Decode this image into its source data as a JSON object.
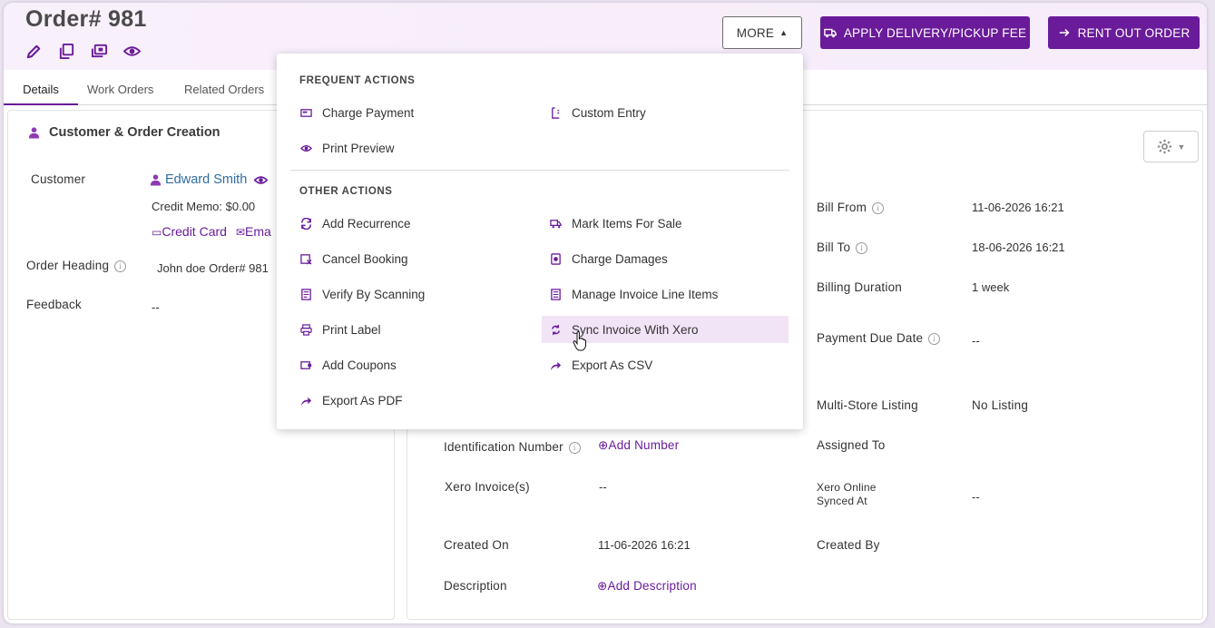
{
  "header": {
    "order_title": "Order# 981",
    "more_label": "MORE",
    "fee_label": "APPLY DELIVERY/PICKUP FEE",
    "rent_label": "RENT OUT ORDER"
  },
  "tabs": [
    {
      "label": "Details"
    },
    {
      "label": "Work Orders"
    },
    {
      "label": "Related Orders"
    }
  ],
  "left_panel": {
    "title": "Customer & Order Creation",
    "customer_label": "Customer",
    "customer_name": "Edward Smith",
    "credit_memo": "Credit Memo: $0.00",
    "credit_card": "Credit Card",
    "email": "Ema",
    "order_heading_label": "Order Heading",
    "order_heading_value": "John doe Order# 981",
    "feedback_label": "Feedback",
    "feedback_value": "--"
  },
  "right_panel": {
    "bill_from_label": "Bill From",
    "bill_from_value": "11-06-2026 16:21",
    "bill_to_label": "Bill To",
    "bill_to_value": "18-06-2026 16:21",
    "billing_duration_label": "Billing Duration",
    "billing_duration_value": "1 week",
    "payment_due_label": "Payment Due Date",
    "payment_due_value": "--",
    "multi_store_label": "Multi-Store Listing",
    "multi_store_value": "No Listing",
    "identification_label": "Identification Number",
    "add_number": "Add Number",
    "assigned_to_label": "Assigned To",
    "xero_invoice_label": "Xero Invoice(s)",
    "xero_invoice_value": "--",
    "xero_online_label_1": "Xero Online",
    "xero_online_label_2": "Synced At",
    "xero_online_value": "--",
    "created_on_label": "Created On",
    "created_on_value": "11-06-2026 16:21",
    "created_by_label": "Created By",
    "description_label": "Description",
    "add_description": "Add Description"
  },
  "dropdown": {
    "frequent_header": "FREQUENT ACTIONS",
    "other_header": "OTHER ACTIONS",
    "frequent": [
      {
        "label": "Charge Payment",
        "icon": "payment-icon"
      },
      {
        "label": "Custom Entry",
        "icon": "custom-entry-icon"
      },
      {
        "label": "Print Preview",
        "icon": "eye-icon"
      }
    ],
    "other": [
      {
        "label": "Add Recurrence",
        "icon": "recurrence-icon"
      },
      {
        "label": "Mark Items For Sale",
        "icon": "truck-icon"
      },
      {
        "label": "Cancel Booking",
        "icon": "cancel-booking-icon"
      },
      {
        "label": "Charge Damages",
        "icon": "damages-icon"
      },
      {
        "label": "Verify By Scanning",
        "icon": "scan-icon"
      },
      {
        "label": "Manage Invoice Line Items",
        "icon": "invoice-icon"
      },
      {
        "label": "Print Label",
        "icon": "printer-icon"
      },
      {
        "label": "Sync Invoice With Xero",
        "icon": "sync-icon"
      },
      {
        "label": "Add Coupons",
        "icon": "coupon-icon"
      },
      {
        "label": "Export As CSV",
        "icon": "export-icon"
      },
      {
        "label": "Export As PDF",
        "icon": "export-icon"
      }
    ]
  },
  "colors": {
    "brand": "#6a1b9a",
    "link_blue": "#2f6ca0",
    "highlight": "#f1e4f7"
  }
}
